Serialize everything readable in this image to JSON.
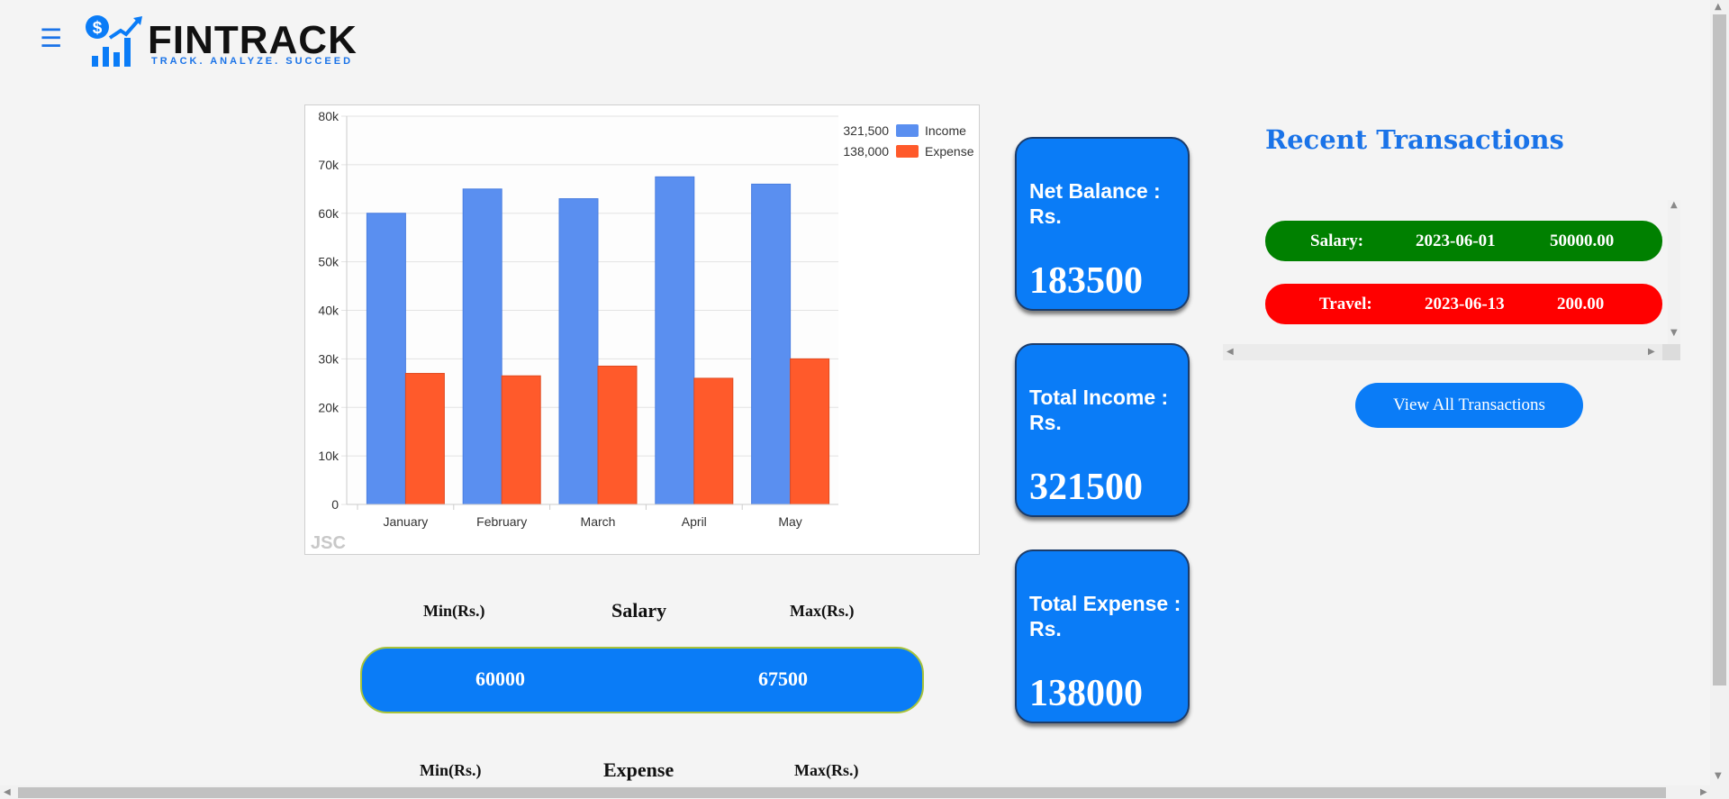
{
  "header": {
    "menu_icon": "☰",
    "brand": "FINTRACK",
    "tagline": "TRACK. ANALYZE. SUCCEED"
  },
  "chart_data": {
    "type": "bar",
    "categories": [
      "January",
      "February",
      "March",
      "April",
      "May"
    ],
    "series": [
      {
        "name": "Income",
        "total": "321,500",
        "color": "#5a8ff0",
        "values": [
          60000,
          65000,
          63000,
          67500,
          66000
        ]
      },
      {
        "name": "Expense",
        "total": "138,000",
        "color": "#ff5a2b",
        "values": [
          27000,
          26500,
          28500,
          26000,
          30000
        ]
      }
    ],
    "y_ticks": [
      "0",
      "10k",
      "20k",
      "30k",
      "40k",
      "50k",
      "60k",
      "70k",
      "80k"
    ],
    "ylim": [
      0,
      80000
    ],
    "grid": true,
    "legend_position": "top-right",
    "watermark": "JSC"
  },
  "salary_range": {
    "min_label": "Min(Rs.)",
    "title": "Salary",
    "max_label": "Max(Rs.)",
    "min_value": "60000",
    "max_value": "67500"
  },
  "expense_range": {
    "min_label": "Min(Rs.)",
    "title": "Expense",
    "max_label": "Max(Rs.)"
  },
  "cards": [
    {
      "title": "Net Balance : Rs.",
      "value": "183500"
    },
    {
      "title": "Total Income : Rs.",
      "value": "321500"
    },
    {
      "title": "Total Expense : Rs.",
      "value": "138000"
    }
  ],
  "transactions": {
    "title": "Recent Transactions",
    "items": [
      {
        "category": "Salary:",
        "date": "2023-06-01",
        "amount": "50000.00",
        "color": "#008000"
      },
      {
        "category": "Travel:",
        "date": "2023-06-13",
        "amount": "200.00",
        "color": "#ff0000"
      }
    ],
    "view_all_label": "View All Transactions"
  },
  "colors": {
    "accent": "#0a7cf7",
    "title_blue": "#1a73e8",
    "income": "#5a8ff0",
    "expense": "#ff5a2b",
    "positive": "#008000",
    "negative": "#ff0000"
  }
}
